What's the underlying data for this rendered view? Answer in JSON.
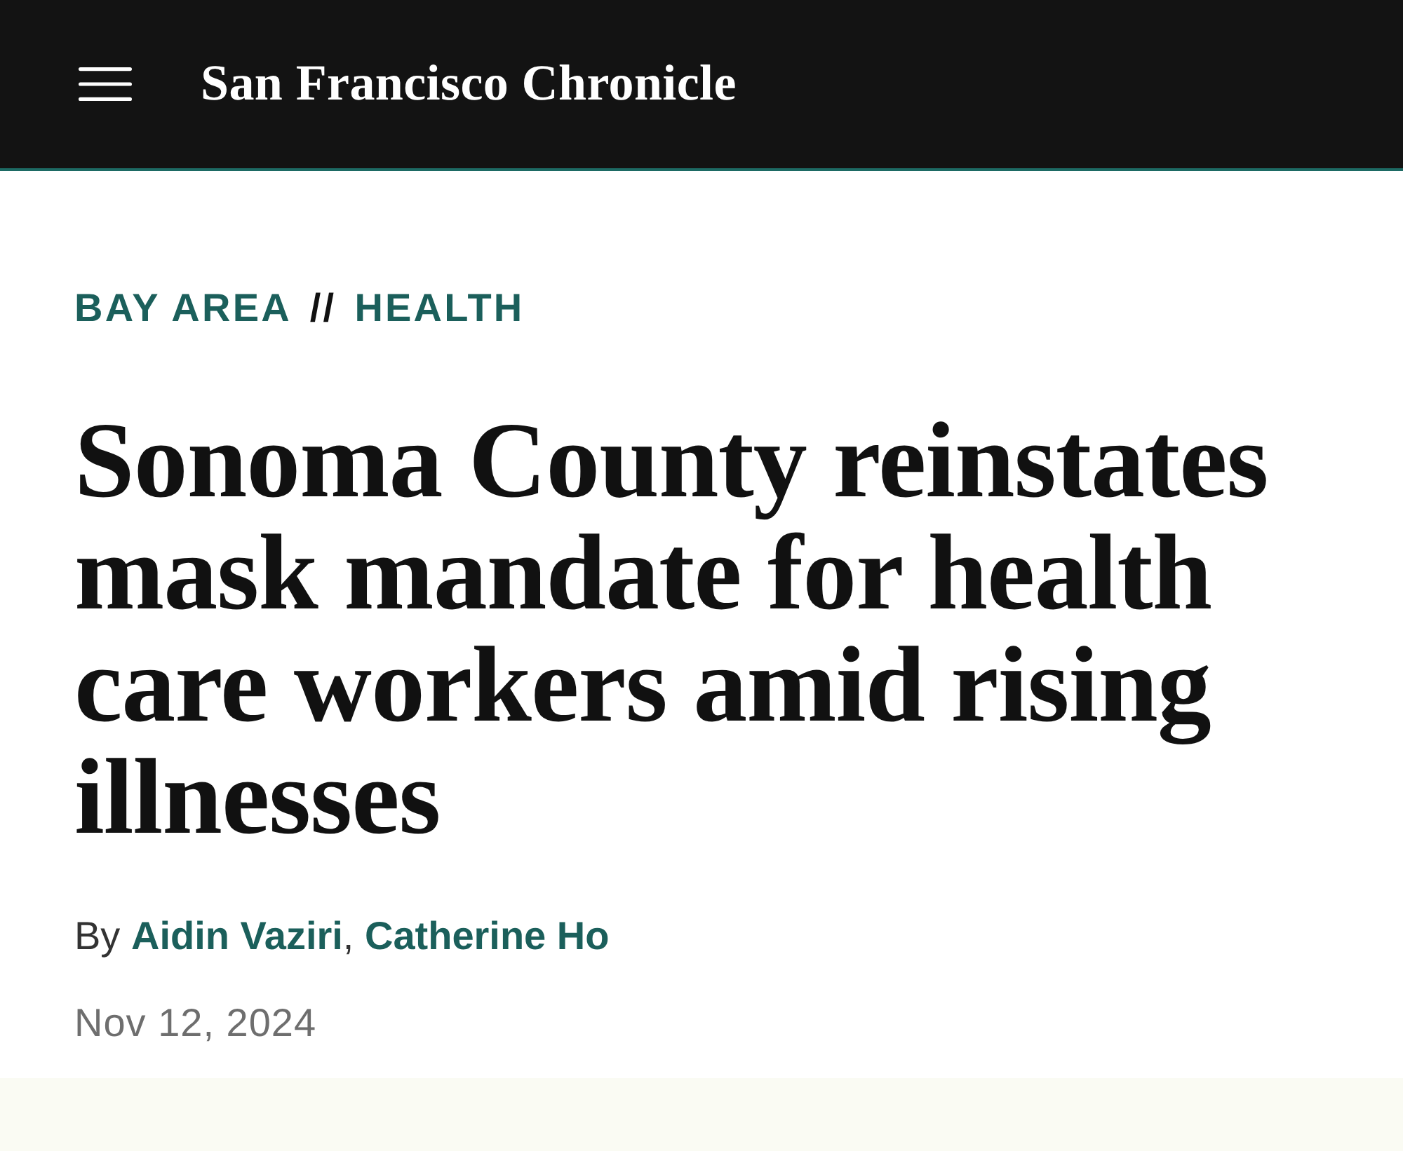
{
  "header": {
    "logo": "San Francisco Chronicle"
  },
  "breadcrumb": {
    "items": [
      "BAY AREA",
      "HEALTH"
    ],
    "separator": "//"
  },
  "headline": "Sonoma County reinstates mask mandate for health care workers amid rising illnesses",
  "byline": {
    "prefix": "By",
    "authors": [
      "Aidin Vaziri",
      "Catherine Ho"
    ],
    "separator": ","
  },
  "date": "Nov 12, 2024"
}
